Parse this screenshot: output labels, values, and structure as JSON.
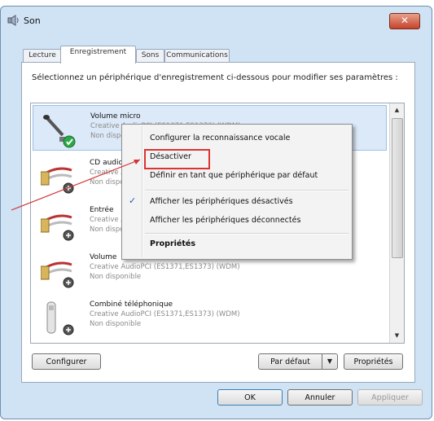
{
  "window": {
    "title": "Son",
    "close_label": "✕"
  },
  "tabs": [
    {
      "label": "Lecture"
    },
    {
      "label": "Enregistrement",
      "active": true
    },
    {
      "label": "Sons"
    },
    {
      "label": "Communications"
    }
  ],
  "instruction": "Sélectionnez un périphérique d'enregistrement ci-dessous pour modifier ses paramètres :",
  "devices": [
    {
      "name": "Volume micro",
      "driver": "Creative AudioPCI (ES1371,ES1373) (WDM)",
      "status": "Non disponible",
      "icon": "microphone-icon",
      "selected": true
    },
    {
      "name": "CD audio",
      "driver": "Creative AudioPCI (ES1371,ES1373) (WDM)",
      "status": "Non disponible",
      "icon": "rca-cable-icon"
    },
    {
      "name": "Entrée",
      "driver": "Creative AudioPCI (ES1371,ES1373) (WDM)",
      "status": "Non disponible",
      "icon": "rca-cable-icon"
    },
    {
      "name": "Volume",
      "driver": "Creative AudioPCI (ES1371,ES1373) (WDM)",
      "status": "Non disponible",
      "icon": "rca-cable-icon"
    },
    {
      "name": "Combiné téléphonique",
      "driver": "Creative AudioPCI (ES1371,ES1373) (WDM)",
      "status": "Non disponible",
      "icon": "telephone-handset-icon"
    }
  ],
  "context_menu": {
    "items": [
      {
        "label": "Configurer la reconnaissance vocale"
      },
      {
        "label": "Désactiver",
        "highlighted": true
      },
      {
        "label": "Définir en tant que périphérique par défaut"
      },
      {
        "label": "Afficher les périphériques désactivés",
        "checked": true
      },
      {
        "label": "Afficher les périphériques déconnectés"
      },
      {
        "label": "Propriétés",
        "bold": true
      }
    ]
  },
  "buttons": {
    "configure": "Configurer",
    "set_default": "Par défaut",
    "properties": "Propriétés",
    "ok": "OK",
    "cancel": "Annuler",
    "apply": "Appliquer"
  },
  "colors": {
    "annotation_red": "#d33333",
    "selection_blue": "#dce9f8",
    "status_green": "#2aa84a"
  }
}
